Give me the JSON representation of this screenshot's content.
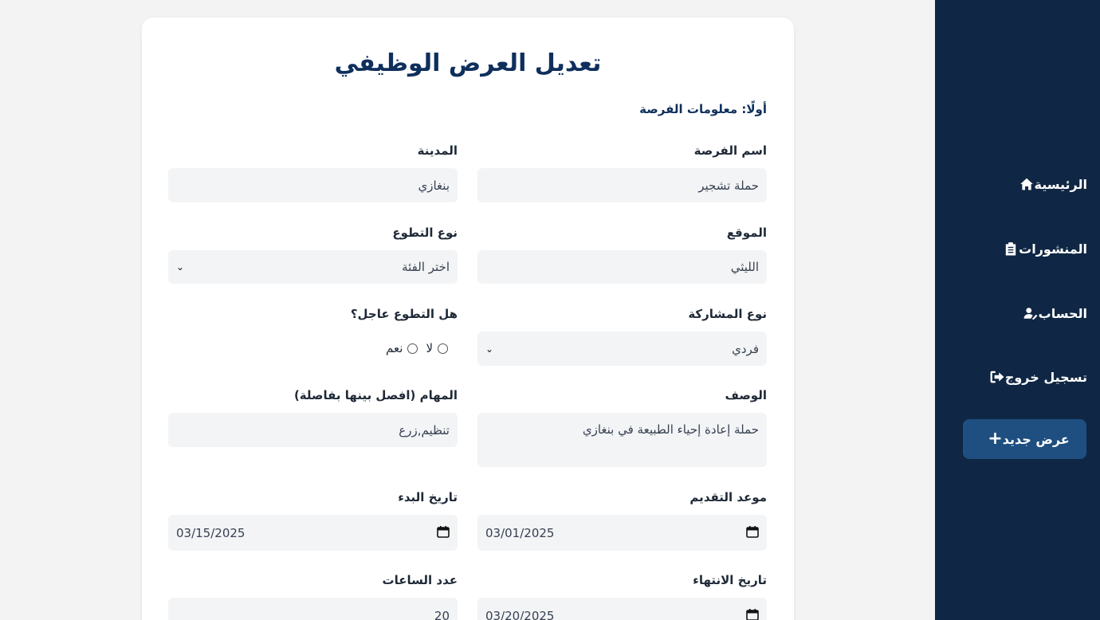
{
  "sidebar": {
    "items": [
      {
        "label": "الرئيسية",
        "icon": "home-icon"
      },
      {
        "label": "المنشورات",
        "icon": "clipboard-icon"
      },
      {
        "label": "الحساب",
        "icon": "user-edit-icon"
      },
      {
        "label": "تسجيل خروج",
        "icon": "logout-icon"
      }
    ],
    "new_button": "عرض جديد",
    "new_button_icon": "plus-icon"
  },
  "form": {
    "title": "تعديل العرض الوظيفي",
    "section": "أولًا: معلومات الفرصة",
    "fields": {
      "name": {
        "label": "اسم الفرصة",
        "value": "حملة تشجير"
      },
      "city": {
        "label": "المدينة",
        "value": "بنغازي"
      },
      "location": {
        "label": "الموقع",
        "value": "الليثي"
      },
      "volunteer_type": {
        "label": "نوع التطوع",
        "value": "اختر الفئة"
      },
      "participation_type": {
        "label": "نوع المشاركة",
        "value": "فردي"
      },
      "urgent": {
        "label": "هل التطوع عاجل؟",
        "options": [
          "نعم",
          "لا"
        ]
      },
      "description": {
        "label": "الوصف",
        "value": "حملة إعادة إحياء الطبيعة في بنغازي"
      },
      "tasks": {
        "label": "المهام (افصل بينها بفاصلة)",
        "value": "تنظيم,زرع"
      },
      "deadline": {
        "label": "موعد التقديم",
        "value": "03/01/2025"
      },
      "start_date": {
        "label": "تاريخ البدء",
        "value": "03/15/2025"
      },
      "end_date": {
        "label": "تاريخ الانتهاء",
        "value": "03/20/2025"
      },
      "hours": {
        "label": "عدد الساعات",
        "value": "20"
      }
    }
  }
}
